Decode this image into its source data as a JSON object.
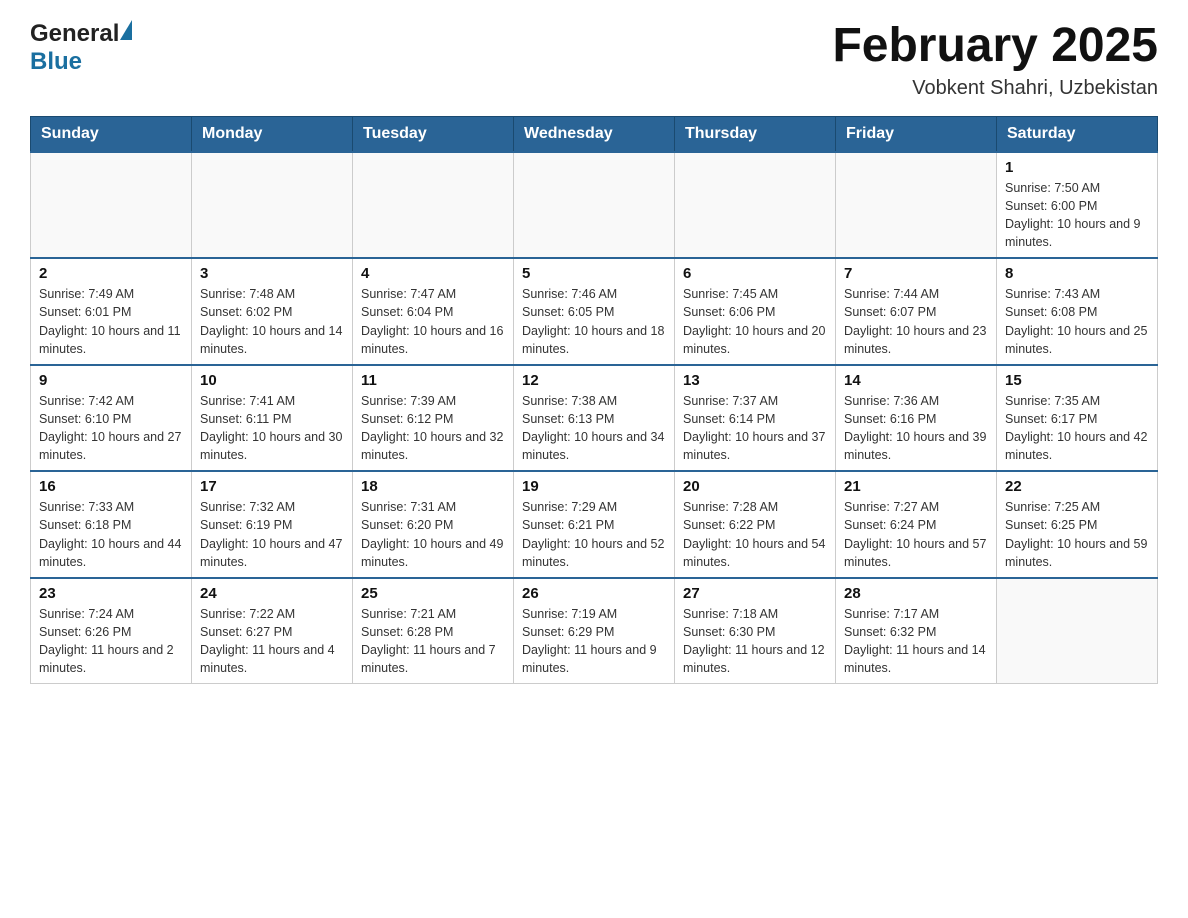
{
  "header": {
    "logo_general": "General",
    "logo_blue": "Blue",
    "month_title": "February 2025",
    "subtitle": "Vobkent Shahri, Uzbekistan"
  },
  "weekdays": [
    "Sunday",
    "Monday",
    "Tuesday",
    "Wednesday",
    "Thursday",
    "Friday",
    "Saturday"
  ],
  "weeks": [
    [
      {
        "day": "",
        "info": ""
      },
      {
        "day": "",
        "info": ""
      },
      {
        "day": "",
        "info": ""
      },
      {
        "day": "",
        "info": ""
      },
      {
        "day": "",
        "info": ""
      },
      {
        "day": "",
        "info": ""
      },
      {
        "day": "1",
        "info": "Sunrise: 7:50 AM\nSunset: 6:00 PM\nDaylight: 10 hours and 9 minutes."
      }
    ],
    [
      {
        "day": "2",
        "info": "Sunrise: 7:49 AM\nSunset: 6:01 PM\nDaylight: 10 hours and 11 minutes."
      },
      {
        "day": "3",
        "info": "Sunrise: 7:48 AM\nSunset: 6:02 PM\nDaylight: 10 hours and 14 minutes."
      },
      {
        "day": "4",
        "info": "Sunrise: 7:47 AM\nSunset: 6:04 PM\nDaylight: 10 hours and 16 minutes."
      },
      {
        "day": "5",
        "info": "Sunrise: 7:46 AM\nSunset: 6:05 PM\nDaylight: 10 hours and 18 minutes."
      },
      {
        "day": "6",
        "info": "Sunrise: 7:45 AM\nSunset: 6:06 PM\nDaylight: 10 hours and 20 minutes."
      },
      {
        "day": "7",
        "info": "Sunrise: 7:44 AM\nSunset: 6:07 PM\nDaylight: 10 hours and 23 minutes."
      },
      {
        "day": "8",
        "info": "Sunrise: 7:43 AM\nSunset: 6:08 PM\nDaylight: 10 hours and 25 minutes."
      }
    ],
    [
      {
        "day": "9",
        "info": "Sunrise: 7:42 AM\nSunset: 6:10 PM\nDaylight: 10 hours and 27 minutes."
      },
      {
        "day": "10",
        "info": "Sunrise: 7:41 AM\nSunset: 6:11 PM\nDaylight: 10 hours and 30 minutes."
      },
      {
        "day": "11",
        "info": "Sunrise: 7:39 AM\nSunset: 6:12 PM\nDaylight: 10 hours and 32 minutes."
      },
      {
        "day": "12",
        "info": "Sunrise: 7:38 AM\nSunset: 6:13 PM\nDaylight: 10 hours and 34 minutes."
      },
      {
        "day": "13",
        "info": "Sunrise: 7:37 AM\nSunset: 6:14 PM\nDaylight: 10 hours and 37 minutes."
      },
      {
        "day": "14",
        "info": "Sunrise: 7:36 AM\nSunset: 6:16 PM\nDaylight: 10 hours and 39 minutes."
      },
      {
        "day": "15",
        "info": "Sunrise: 7:35 AM\nSunset: 6:17 PM\nDaylight: 10 hours and 42 minutes."
      }
    ],
    [
      {
        "day": "16",
        "info": "Sunrise: 7:33 AM\nSunset: 6:18 PM\nDaylight: 10 hours and 44 minutes."
      },
      {
        "day": "17",
        "info": "Sunrise: 7:32 AM\nSunset: 6:19 PM\nDaylight: 10 hours and 47 minutes."
      },
      {
        "day": "18",
        "info": "Sunrise: 7:31 AM\nSunset: 6:20 PM\nDaylight: 10 hours and 49 minutes."
      },
      {
        "day": "19",
        "info": "Sunrise: 7:29 AM\nSunset: 6:21 PM\nDaylight: 10 hours and 52 minutes."
      },
      {
        "day": "20",
        "info": "Sunrise: 7:28 AM\nSunset: 6:22 PM\nDaylight: 10 hours and 54 minutes."
      },
      {
        "day": "21",
        "info": "Sunrise: 7:27 AM\nSunset: 6:24 PM\nDaylight: 10 hours and 57 minutes."
      },
      {
        "day": "22",
        "info": "Sunrise: 7:25 AM\nSunset: 6:25 PM\nDaylight: 10 hours and 59 minutes."
      }
    ],
    [
      {
        "day": "23",
        "info": "Sunrise: 7:24 AM\nSunset: 6:26 PM\nDaylight: 11 hours and 2 minutes."
      },
      {
        "day": "24",
        "info": "Sunrise: 7:22 AM\nSunset: 6:27 PM\nDaylight: 11 hours and 4 minutes."
      },
      {
        "day": "25",
        "info": "Sunrise: 7:21 AM\nSunset: 6:28 PM\nDaylight: 11 hours and 7 minutes."
      },
      {
        "day": "26",
        "info": "Sunrise: 7:19 AM\nSunset: 6:29 PM\nDaylight: 11 hours and 9 minutes."
      },
      {
        "day": "27",
        "info": "Sunrise: 7:18 AM\nSunset: 6:30 PM\nDaylight: 11 hours and 12 minutes."
      },
      {
        "day": "28",
        "info": "Sunrise: 7:17 AM\nSunset: 6:32 PM\nDaylight: 11 hours and 14 minutes."
      },
      {
        "day": "",
        "info": ""
      }
    ]
  ],
  "accent_color": "#2a6496"
}
